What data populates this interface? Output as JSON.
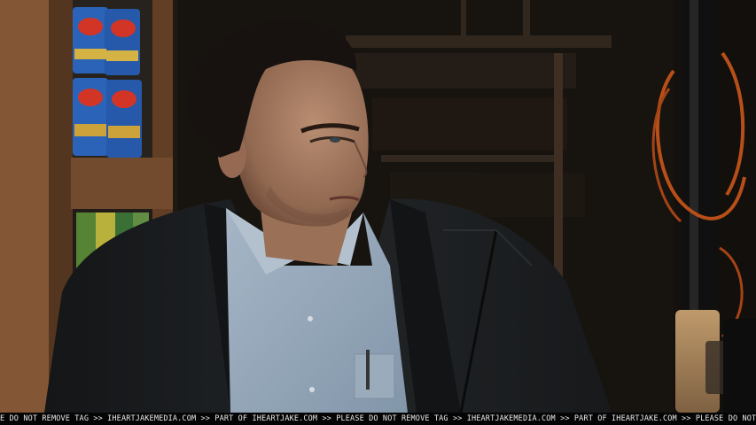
{
  "watermark": {
    "text": "E DO NOT REMOVE TAG >> IHEARTJAKEMEDIA.COM >> PART OF IHEARTJAKE.COM >> PLEASE DO NOT REMOVE TAG >> IHEARTJAKEMEDIA.COM >> PART OF IHEARTJAKE.COM >> PLEASE DO NOT REMOVE TAG >> IHEARTJAKEMEDIA"
  },
  "colors": {
    "background_dark": "#1b1611",
    "wood_shelf": "#7a5030",
    "shirt": "#9fb3c8",
    "jacket": "#1f2124",
    "skin": "#b88a6e",
    "hair": "#1a1412",
    "hose_orange": "#c8561c"
  }
}
